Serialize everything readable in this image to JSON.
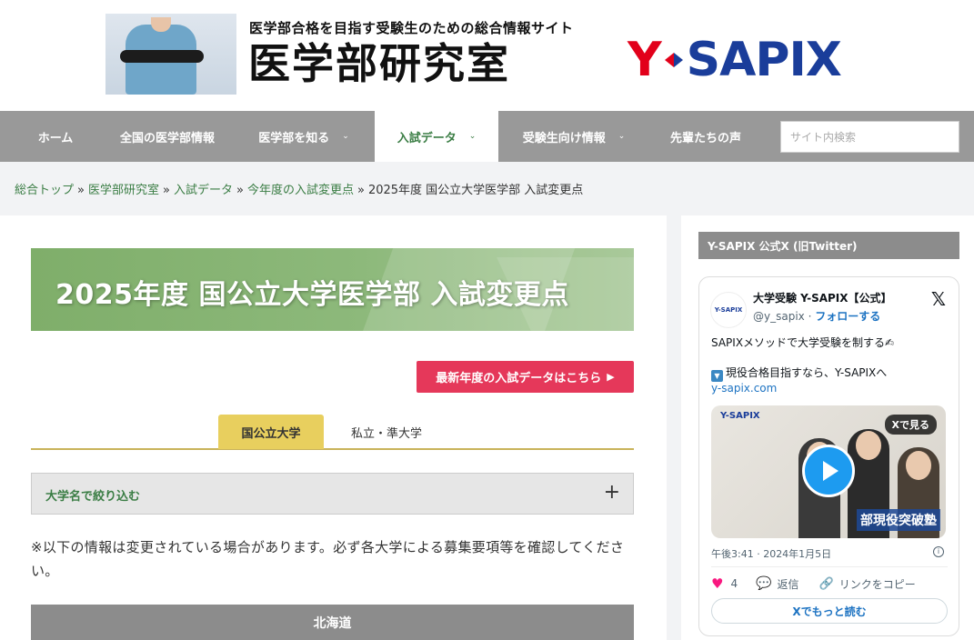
{
  "header": {
    "tagline": "医学部合格を目指す受験生のための総合情報サイト",
    "site_title": "医学部研究室",
    "brand": {
      "y": "Y",
      "sapix": "SAPIX"
    }
  },
  "nav": {
    "items": [
      {
        "label": "ホーム",
        "has_dropdown": false
      },
      {
        "label": "全国の医学部情報",
        "has_dropdown": false
      },
      {
        "label": "医学部を知る",
        "has_dropdown": true
      },
      {
        "label": "入試データ",
        "has_dropdown": true,
        "active": true
      },
      {
        "label": "受験生向け情報",
        "has_dropdown": true
      },
      {
        "label": "先輩たちの声",
        "has_dropdown": false
      }
    ],
    "search_placeholder": "サイト内検索"
  },
  "breadcrumb": {
    "links": [
      "総合トップ",
      "医学部研究室",
      "入試データ",
      "今年度の入試変更点"
    ],
    "separator": "»",
    "current": "2025年度 国公立大学医学部 入試変更点"
  },
  "main": {
    "page_title": "2025年度 国公立大学医学部 入試変更点",
    "cta_label": "最新年度の入試データはこちら",
    "cta_arrow": "▶",
    "tabs": [
      {
        "label": "国公立大学",
        "active": true
      },
      {
        "label": "私立・準大学",
        "active": false
      }
    ],
    "filter_label": "大学名で絞り込む",
    "filter_toggle": "+",
    "notice": "※以下の情報は変更されている場合があります。必ず各大学による募集要項等を確認してください。",
    "region_header": "北海道"
  },
  "sidebar": {
    "widget_title": "Y-SAPIX 公式X (旧Twitter)",
    "post": {
      "account_name": "大学受験 Y-SAPIX【公式】",
      "handle": "@y_sapix",
      "handle_sep": " · ",
      "follow_label": "フォローする",
      "avatar_text": "Y-SAPIX",
      "text_line1": "SAPIXメソッドで大学受験を制する✍",
      "text_line2_icon": "▼",
      "text_line2": "現役合格目指すなら、Y-SAPIXへ",
      "link": "y-sapix.com",
      "media_brand": "Y-SAPIX",
      "view_on_x": "Xで見る",
      "media_caption": "部現役突破塾",
      "date": "午後3:41 · 2024年1月5日",
      "likes": "4",
      "reply_label": "返信",
      "copy_link_label": "リンクをコピー",
      "read_more_label": "Xでもっと読む"
    }
  },
  "colors": {
    "nav_bg": "#999999",
    "accent_green": "#3a7d44",
    "cta_red": "#e5385a",
    "tab_yellow": "#e8cf5e",
    "brand_red": "#e2001a",
    "brand_blue": "#1a3d9a",
    "x_blue": "#1d9bf0"
  }
}
